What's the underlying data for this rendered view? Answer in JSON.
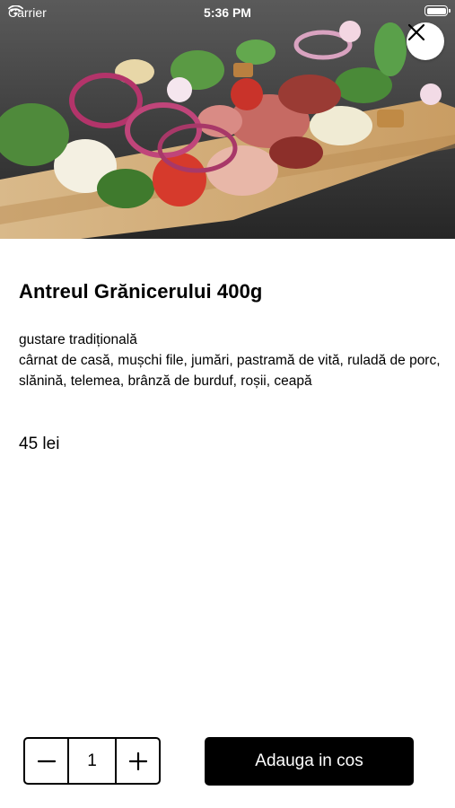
{
  "status_bar": {
    "carrier": "Carrier",
    "time": "5:36 PM",
    "wifi_icon": "wifi-icon",
    "battery_level": 1.0
  },
  "hero": {
    "image_icon": "food-photo",
    "close_icon": "close-icon"
  },
  "product": {
    "title": "Antreul Grănicerului 400g",
    "subtitle": "gustare tradițională",
    "ingredients": "cârnat de casă, mușchi file, jumări, pastramă de vită, ruladă de porc, slănină, telemea, brânză de burduf, roșii, ceapă",
    "price": "45 lei"
  },
  "cart": {
    "quantity": "1",
    "decrement_icon": "minus-icon",
    "increment_icon": "plus-icon",
    "add_label": "Adauga in cos"
  },
  "colors": {
    "primary": "#000000",
    "background": "#ffffff"
  }
}
